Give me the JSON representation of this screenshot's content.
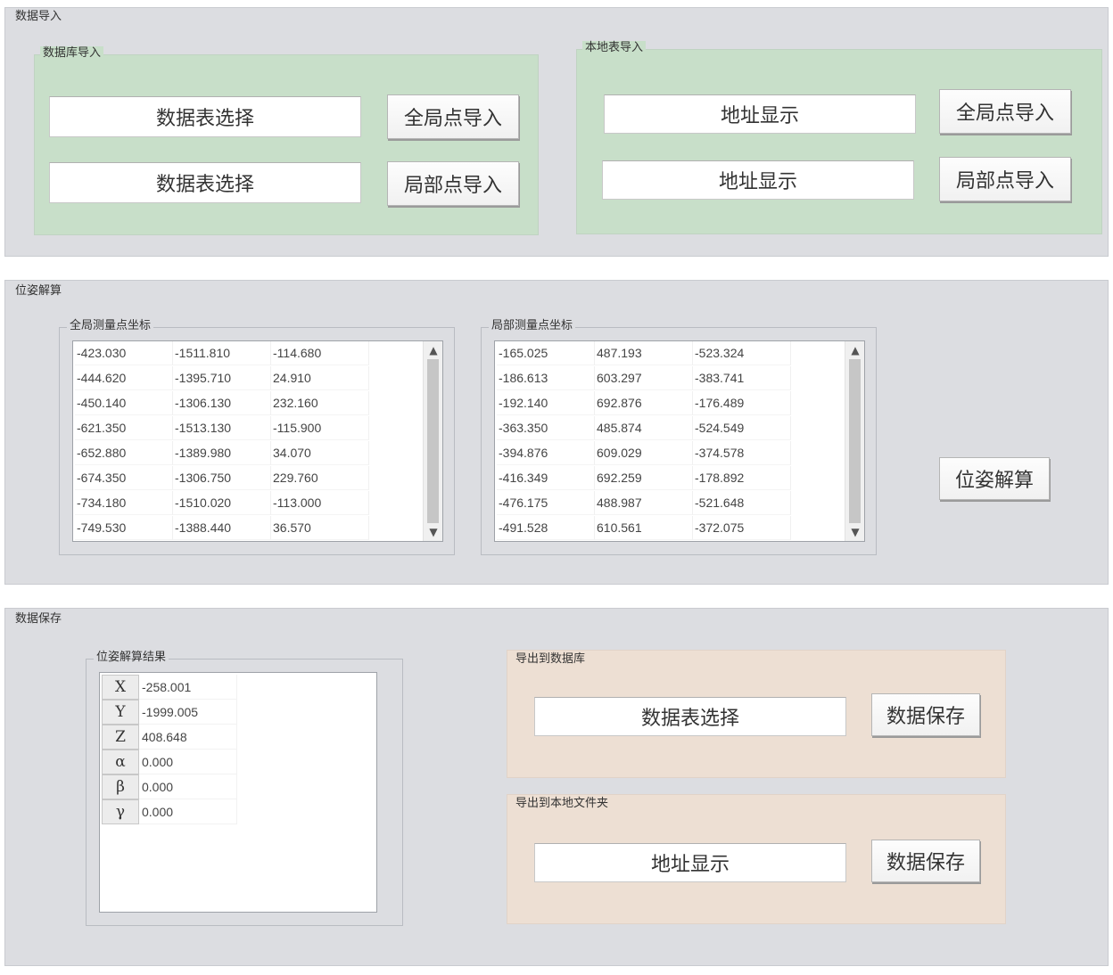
{
  "import": {
    "title": "数据导入",
    "database": {
      "title": "数据库导入",
      "table_select_1": "数据表选择",
      "table_select_2": "数据表选择",
      "global_import": "全局点导入",
      "local_import": "局部点导入"
    },
    "local_table": {
      "title": "本地表导入",
      "address_1": "地址显示",
      "address_2": "地址显示",
      "global_import": "全局点导入",
      "local_import": "局部点导入"
    }
  },
  "solve": {
    "title": "位姿解算",
    "global_points": {
      "title": "全局测量点坐标",
      "rows": [
        [
          "-423.030",
          "-1511.810",
          "-114.680"
        ],
        [
          "-444.620",
          "-1395.710",
          "24.910"
        ],
        [
          "-450.140",
          "-1306.130",
          "232.160"
        ],
        [
          "-621.350",
          "-1513.130",
          "-115.900"
        ],
        [
          "-652.880",
          "-1389.980",
          "34.070"
        ],
        [
          "-674.350",
          "-1306.750",
          "229.760"
        ],
        [
          "-734.180",
          "-1510.020",
          "-113.000"
        ],
        [
          "-749.530",
          "-1388.440",
          "36.570"
        ]
      ]
    },
    "local_points": {
      "title": "局部测量点坐标",
      "rows": [
        [
          "-165.025",
          "487.193",
          "-523.324"
        ],
        [
          "-186.613",
          "603.297",
          "-383.741"
        ],
        [
          "-192.140",
          "692.876",
          "-176.489"
        ],
        [
          "-363.350",
          "485.874",
          "-524.549"
        ],
        [
          "-394.876",
          "609.029",
          "-374.578"
        ],
        [
          "-416.349",
          "692.259",
          "-178.892"
        ],
        [
          "-476.175",
          "488.987",
          "-521.648"
        ],
        [
          "-491.528",
          "610.561",
          "-372.075"
        ]
      ]
    },
    "solve_button": "位姿解算"
  },
  "save": {
    "title": "数据保存",
    "result": {
      "title": "位姿解算结果",
      "rows": [
        {
          "label": "X",
          "value": "-258.001"
        },
        {
          "label": "Y",
          "value": "-1999.005"
        },
        {
          "label": "Z",
          "value": "408.648"
        },
        {
          "label": "α",
          "value": "0.000"
        },
        {
          "label": "β",
          "value": "0.000"
        },
        {
          "label": "γ",
          "value": "0.000"
        }
      ]
    },
    "to_database": {
      "title": "导出到数据库",
      "table_select": "数据表选择",
      "save_button": "数据保存"
    },
    "to_local": {
      "title": "导出到本地文件夹",
      "address": "地址显示",
      "save_button": "数据保存"
    }
  },
  "colors": {
    "panel": "#dcdde1",
    "green_group": "#c8dfc9",
    "peach_group": "#eddfd3"
  }
}
